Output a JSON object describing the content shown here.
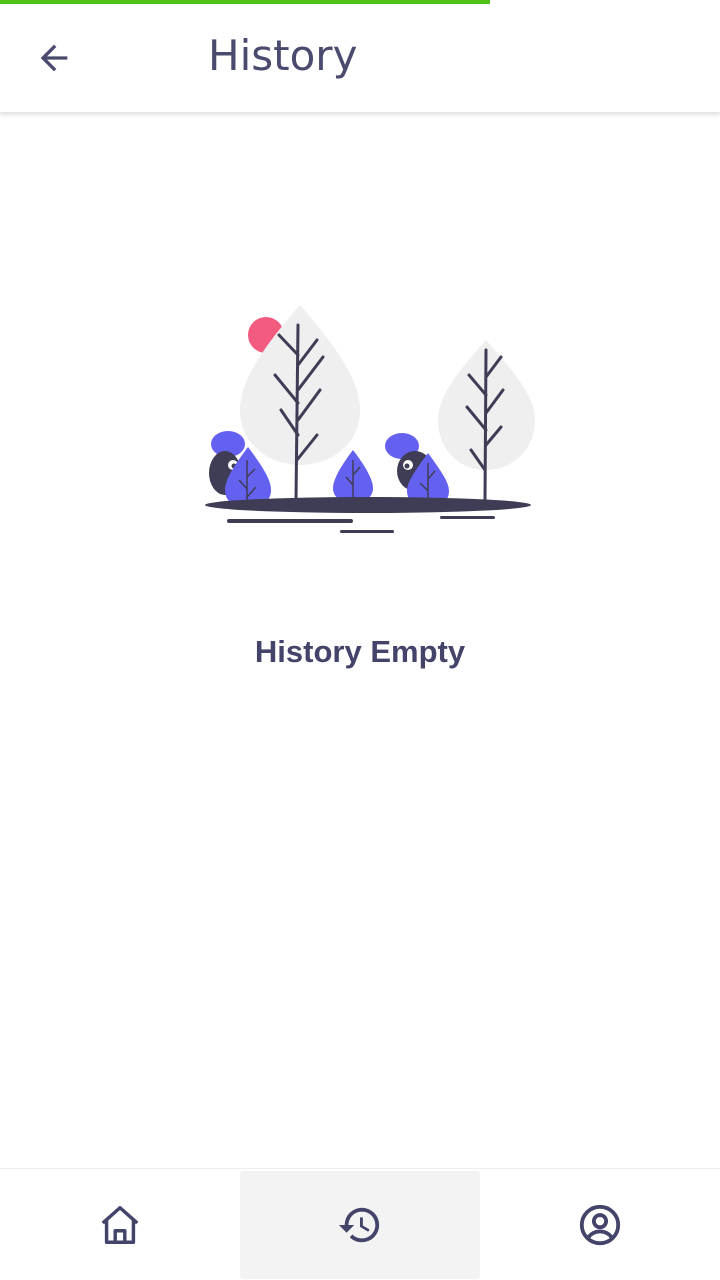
{
  "progress": {
    "value": 0.68,
    "color": "#4fc21a"
  },
  "appbar": {
    "title": "History",
    "back_icon": "arrow-left-icon"
  },
  "empty_state": {
    "message": "History Empty",
    "illustration": "empty-forest-illustration"
  },
  "bottom_nav": {
    "items": [
      {
        "icon": "home-icon",
        "active": false
      },
      {
        "icon": "history-icon",
        "active": true
      },
      {
        "icon": "account-circle-icon",
        "active": false
      }
    ]
  },
  "colors": {
    "text": "#44446a",
    "accent": "#6461f0",
    "pink": "#f25a7f",
    "tree": "#efefef",
    "dark": "#3f3d56"
  }
}
